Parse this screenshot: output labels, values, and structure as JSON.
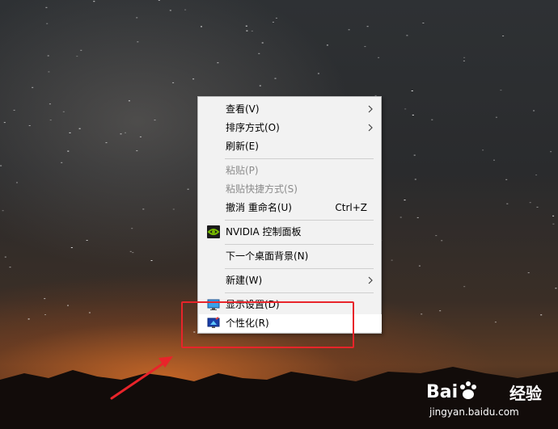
{
  "menu": {
    "items": [
      {
        "label": "查看(V)",
        "submenu": true,
        "enabled": true
      },
      {
        "label": "排序方式(O)",
        "submenu": true,
        "enabled": true
      },
      {
        "label": "刷新(E)",
        "enabled": true
      },
      {
        "label": "粘贴(P)",
        "enabled": false
      },
      {
        "label": "粘贴快捷方式(S)",
        "enabled": false
      },
      {
        "label": "撤消 重命名(U)",
        "shortcut": "Ctrl+Z",
        "enabled": true
      },
      {
        "label": "NVIDIA 控制面板",
        "icon": "nvidia-icon",
        "enabled": true
      },
      {
        "label": "下一个桌面背景(N)",
        "enabled": true
      },
      {
        "label": "新建(W)",
        "submenu": true,
        "enabled": true
      },
      {
        "label": "显示设置(D)",
        "icon": "display-settings-icon",
        "enabled": true
      },
      {
        "label": "个性化(R)",
        "icon": "personalize-icon",
        "enabled": true,
        "highlighted": true
      }
    ]
  },
  "annotation": {
    "highlight_color": "#e8242a"
  },
  "watermark": {
    "brand": "Bai",
    "brand_suffix": "经验",
    "url": "jingyan.baidu.com"
  }
}
